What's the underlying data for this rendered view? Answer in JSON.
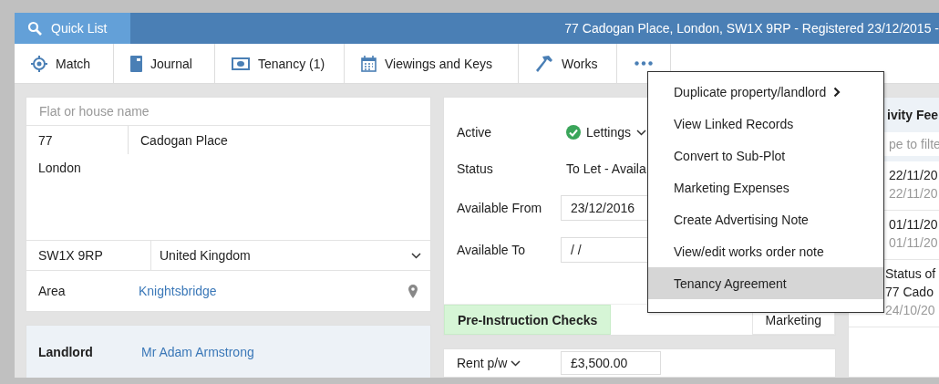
{
  "quick_list": {
    "label": "Quick List"
  },
  "title": "77 Cadogan Place, London, SW1X 9RP - Registered 23/12/2015 -",
  "toolbar": [
    {
      "label": "Match",
      "kind": "target"
    },
    {
      "label": "Journal",
      "kind": "book"
    },
    {
      "label": "Tenancy (1)",
      "kind": "money"
    },
    {
      "label": "Viewings and Keys",
      "kind": "calendar"
    },
    {
      "label": "Works",
      "kind": "hammer"
    }
  ],
  "address": {
    "placeholder": "Flat or house name",
    "number": "77",
    "street": "Cadogan Place",
    "town": "London",
    "postcode": "SW1X 9RP",
    "country": "United Kingdom",
    "area_label": "Area",
    "area": "Knightsbridge"
  },
  "landlord": {
    "label": "Landlord",
    "name": "Mr Adam Armstrong"
  },
  "details": [
    {
      "label": "Active",
      "kind": "status",
      "value": "Lettings"
    },
    {
      "label": "Status",
      "kind": "text",
      "value": "To Let - Availa"
    },
    {
      "label": "Available From",
      "kind": "input",
      "value": "23/12/2016"
    },
    {
      "label": "Available To",
      "kind": "input",
      "value": "/ /"
    }
  ],
  "tabs": [
    {
      "label": "Pre-Instruction Checks",
      "selected": true
    },
    {
      "label": "Marketing",
      "selected": false
    }
  ],
  "rent": {
    "label": "Rent p/w",
    "value": "£3,500.00"
  },
  "activity_feed": {
    "title": "ivity Fee",
    "filter_placeholder": "pe to filte",
    "items": [
      {
        "kind": "plain",
        "lines": [
          "22/11/20",
          "22/11/20"
        ]
      },
      {
        "kind": "plain",
        "lines": [
          "01/11/20",
          "01/11/20"
        ]
      },
      {
        "kind": "note",
        "lines": [
          "Status of",
          "77 Cado",
          "24/10/20"
        ]
      }
    ]
  },
  "menu": [
    {
      "label": "Duplicate property/landlord",
      "submenu": true,
      "selected": false
    },
    {
      "label": "View Linked Records",
      "submenu": false,
      "selected": false
    },
    {
      "label": "Convert to Sub-Plot",
      "submenu": false,
      "selected": false
    },
    {
      "label": "Marketing Expenses",
      "submenu": false,
      "selected": false
    },
    {
      "label": "Create Advertising Note",
      "submenu": false,
      "selected": false
    },
    {
      "label": "View/edit works order note",
      "submenu": false,
      "selected": false
    },
    {
      "label": "Tenancy Agreement",
      "submenu": false,
      "selected": true
    }
  ]
}
